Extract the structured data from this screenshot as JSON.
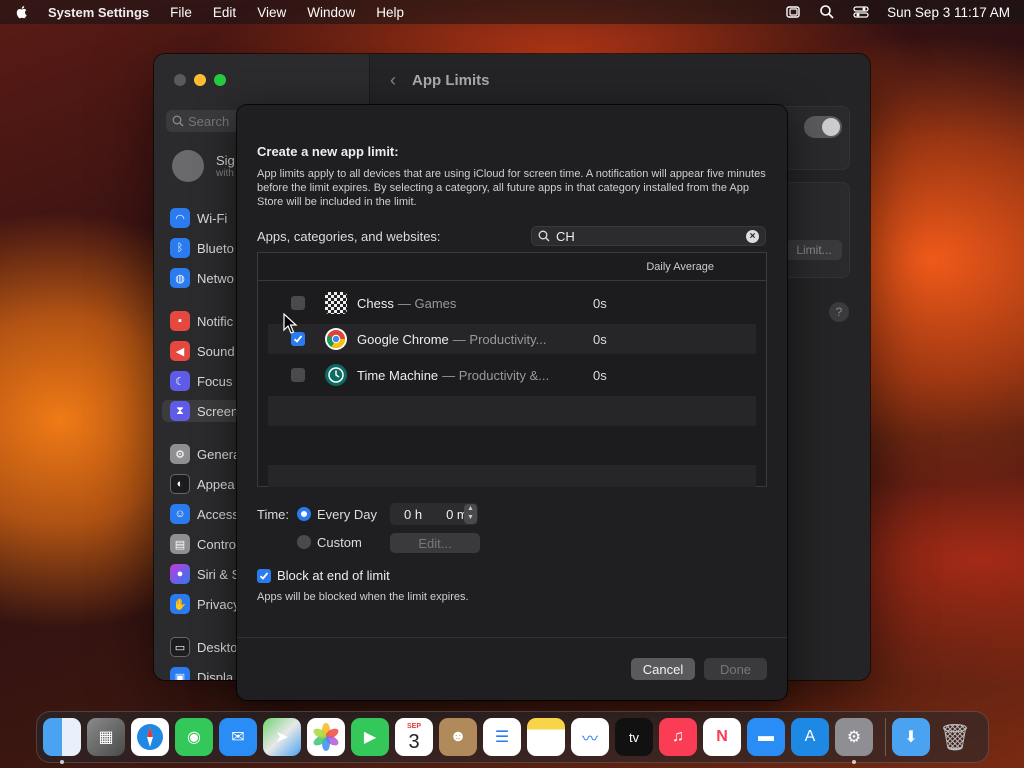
{
  "menubar": {
    "app_name": "System Settings",
    "menus": [
      "File",
      "Edit",
      "View",
      "Window",
      "Help"
    ],
    "clock": "Sun Sep 3  11:17 AM"
  },
  "window": {
    "search_placeholder": "Search",
    "account_line1": "Sig",
    "account_line2": "with",
    "sidebar": [
      "Wi-Fi",
      "Blueto",
      "Netwo",
      "Notific",
      "Sound",
      "Focus",
      "Screen",
      "Genera",
      "Appea",
      "Access",
      "Contro",
      "Siri & S",
      "Privacy",
      "Deskto",
      "Displa"
    ],
    "header_title": "App Limits",
    "bg_limit_button": "Limit...",
    "help": "?"
  },
  "sheet": {
    "title": "Create a new app limit:",
    "description": "App limits apply to all devices that are using iCloud for screen time. A notification will appear five minutes before the limit expires. By selecting a category, all future apps in that category installed from the App Store will be included in the limit.",
    "apps_label": "Apps, categories, and websites:",
    "filter_value": "CH",
    "column_daily_average": "Daily Average",
    "rows": [
      {
        "name": "Chess",
        "category": "— Games",
        "avg": "0s",
        "checked": false
      },
      {
        "name": "Google Chrome",
        "category": "— Productivity...",
        "avg": "0s",
        "checked": true
      },
      {
        "name": "Time Machine",
        "category": "— Productivity &...",
        "avg": "0s",
        "checked": false
      }
    ],
    "time_label": "Time:",
    "every_day": "Every Day",
    "custom": "Custom",
    "hours": "0 h",
    "minutes": "0 m",
    "edit_button": "Edit...",
    "block_label": "Block at end of limit",
    "block_note": "Apps will be blocked when the limit expires.",
    "cancel": "Cancel",
    "done": "Done"
  },
  "dock": {
    "calendar_month": "SEP",
    "calendar_day": "3",
    "tv_label": "tv"
  },
  "colors": {
    "accent": "#2a7af0",
    "sheet_bg": "#1f1f21"
  }
}
